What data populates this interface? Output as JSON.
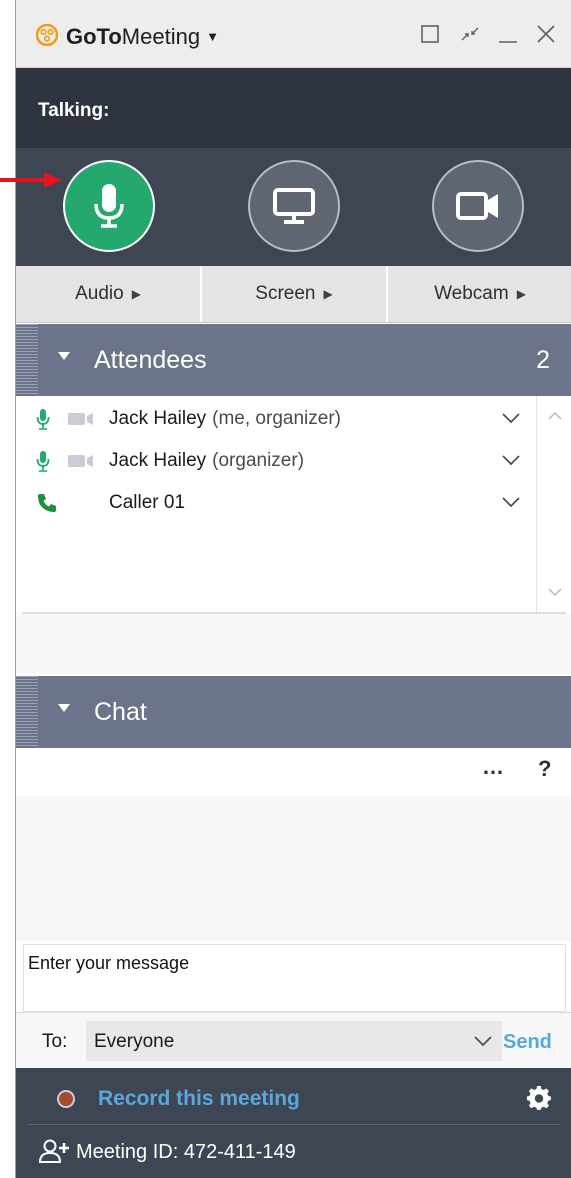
{
  "window": {
    "brand_bold": "GoTo",
    "brand_light": "Meeting",
    "title_menu_icon": "caret-down-icon",
    "controls": [
      "maximize-icon",
      "collapse-icon",
      "minimize-icon",
      "close-icon"
    ]
  },
  "talking": {
    "label": "Talking:"
  },
  "controls": {
    "audio": {
      "icon": "microphone-icon",
      "state": "on",
      "color": "#25a86d"
    },
    "screen": {
      "icon": "monitor-icon"
    },
    "webcam": {
      "icon": "video-camera-icon"
    }
  },
  "tabs": [
    {
      "label": "Audio"
    },
    {
      "label": "Screen"
    },
    {
      "label": "Webcam"
    }
  ],
  "attendees": {
    "title": "Attendees",
    "count": "2",
    "rows": [
      {
        "name": "Jack Hailey",
        "role": "(me, organizer)",
        "audio_icon": "microphone-icon",
        "video_icon": "video-camera-icon"
      },
      {
        "name": "Jack Hailey",
        "role": "(organizer)",
        "audio_icon": "microphone-icon",
        "video_icon": "video-camera-icon"
      },
      {
        "name": "Caller 01",
        "role": "",
        "audio_icon": "phone-icon"
      }
    ]
  },
  "chat": {
    "title": "Chat",
    "more": "…",
    "help": "?",
    "message_placeholder": "Enter your message",
    "to_label": "To:",
    "to_value": "Everyone",
    "send_label": "Send"
  },
  "footer": {
    "record_label": "Record this meeting",
    "meeting_id_label": "Meeting ID: 472-411-149"
  },
  "colors": {
    "accent_green": "#25a86d",
    "link_blue": "#5aa7dc",
    "dark_panel": "#3e4654",
    "section_header": "#6b7488",
    "brand_orange": "#f39c12",
    "annotation_red": "#e8131b"
  }
}
